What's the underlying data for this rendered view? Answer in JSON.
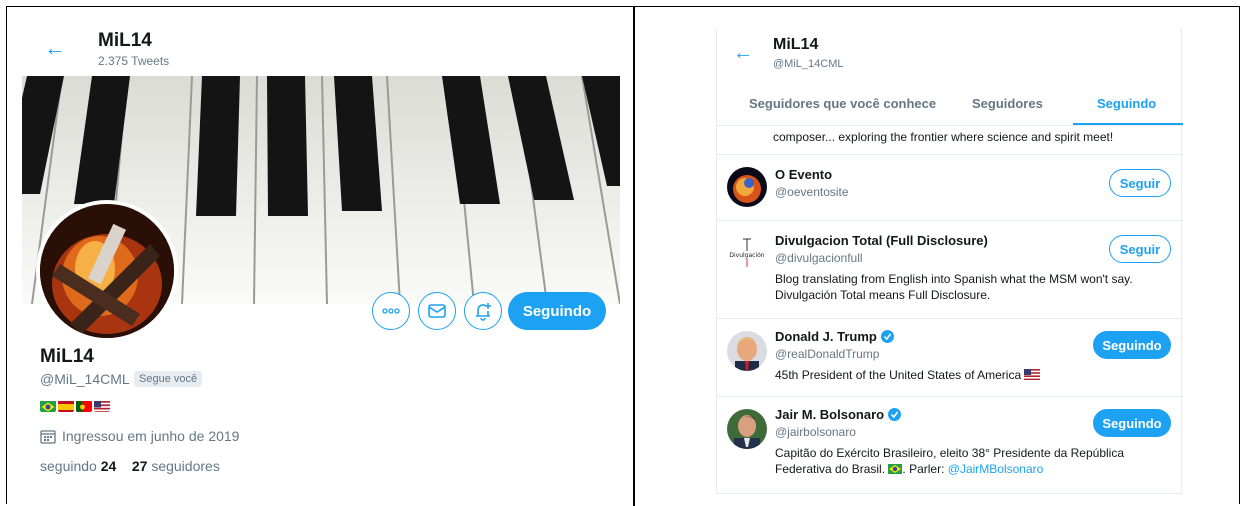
{
  "left": {
    "header_name": "MiL14",
    "tweet_count": "2.375 Tweets",
    "profile_name": "MiL14",
    "handle": "@MiL_14CML",
    "follows_you": "Segue você",
    "follow_button": "Seguindo",
    "joined": "Ingressou em junho de 2019",
    "following_label": "seguindo",
    "following_count": "24",
    "followers_count": "27",
    "followers_label": "seguidores",
    "flags": [
      "brazil-flag-icon",
      "spain-flag-icon",
      "portugal-flag-icon",
      "usa-flag-icon"
    ]
  },
  "right": {
    "header_name": "MiL14",
    "handle": "@MiL_14CML",
    "tabs": [
      "Seguidores que você conhece",
      "Seguidores",
      "Seguindo"
    ],
    "active_tab": "Seguindo",
    "truncated_bio": "composer... exploring the frontier where science and spirit meet!",
    "accounts": [
      {
        "name": "O Evento",
        "handle": "@oeventosite",
        "bio": "",
        "button": "Seguir",
        "verified": false
      },
      {
        "name": "Divulgacion Total (Full Disclosure)",
        "handle": "@divulgacionfull",
        "bio": "Blog translating from English into Spanish what the MSM won't say. Divulgación Total means Full Disclosure.",
        "button": "Seguir",
        "verified": false,
        "avatar_text": "Divulgación"
      },
      {
        "name": "Donald J. Trump",
        "handle": "@realDonaldTrump",
        "bio": "45th President of the United States of America",
        "button": "Seguindo",
        "verified": true
      },
      {
        "name": "Jair M. Bolsonaro",
        "handle": "@jairbolsonaro",
        "bio_part1": "Capitão do Exército Brasileiro, eleito 38° Presidente da República Federativa do Brasil.",
        "bio_part2": ". Parler: ",
        "bio_link": "@JairMBolsonaro",
        "button": "Seguindo",
        "verified": true
      }
    ]
  },
  "colors": {
    "accent": "#1da1f2",
    "secondary_text": "#657786",
    "border": "#e6ecf0"
  }
}
